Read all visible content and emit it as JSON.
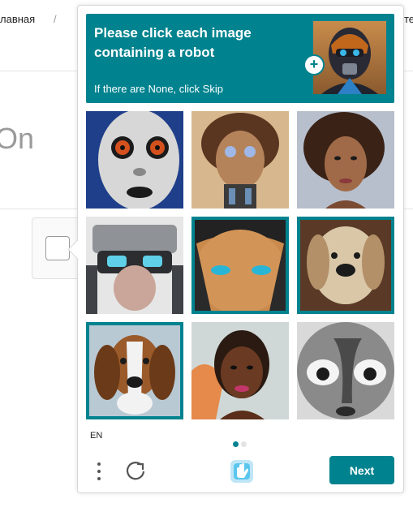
{
  "background_page": {
    "breadcrumb_home": "лавная",
    "breadcrumb_separator": "/",
    "right_fragment": "те",
    "heading_fragment": "On"
  },
  "captcha": {
    "prompt_title": "Please click each image containing a robot",
    "prompt_subtitle": "If there are None, click Skip",
    "accent_color": "#00838f",
    "tiles": [
      {
        "subject": "white robot with orange eyes",
        "selected": false
      },
      {
        "subject": "robot with curly hair",
        "selected": false
      },
      {
        "subject": "woman with curly hair",
        "selected": false
      },
      {
        "subject": "robot helmet with goggles",
        "selected": false
      },
      {
        "subject": "close-up face with blue eyes",
        "selected": true
      },
      {
        "subject": "long-haired dog",
        "selected": true
      },
      {
        "subject": "beagle dog",
        "selected": true
      },
      {
        "subject": "woman portrait painting",
        "selected": false
      },
      {
        "subject": "grayscale cartoon face",
        "selected": false
      }
    ],
    "language": "EN",
    "page_indicator": {
      "current": 1,
      "total": 2
    },
    "next_label": "Next",
    "icons": {
      "menu": "more-vertical-icon",
      "refresh": "refresh-icon",
      "logo": "hcaptcha-logo-icon",
      "example": "plus-icon"
    }
  }
}
